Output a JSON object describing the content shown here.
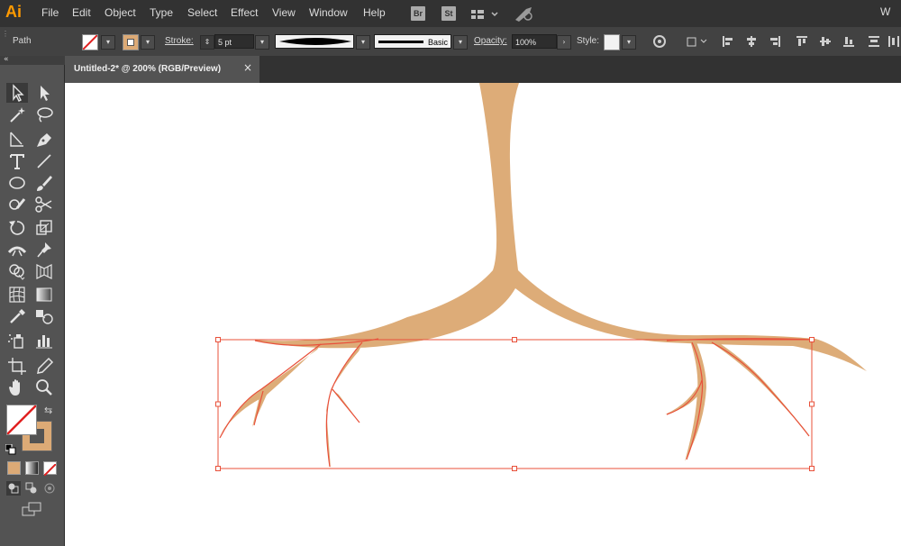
{
  "app": {
    "logo": "Ai"
  },
  "menu": [
    "File",
    "Edit",
    "Object",
    "Type",
    "Select",
    "Effect",
    "View",
    "Window",
    "Help"
  ],
  "menu_badges": {
    "bridge": "Br",
    "stock": "St"
  },
  "menubar_right_text": "W",
  "control_bar": {
    "selection_type": "Path",
    "stroke_label": "Stroke:",
    "stroke_weight": "5 pt",
    "brush_label": "Basic",
    "opacity_label": "Opacity:",
    "opacity_value": "100%",
    "style_label": "Style:"
  },
  "document": {
    "tab_title": "Untitled-2* @ 200% (RGB/Preview)",
    "close_glyph": "×"
  },
  "colors": {
    "fill": "#dcaa76",
    "artwork": "#ddac78",
    "selection": "#e8503a",
    "canvas": "#ffffff",
    "panel": "#535353",
    "menubar": "#323232",
    "logo": "#ff9a00"
  },
  "tools": [
    "selection-tool",
    "direct-selection-tool",
    "magic-wand-tool",
    "lasso-tool",
    "line-segment-tool",
    "pen-tool",
    "type-tool",
    "line-tool",
    "ellipse-tool",
    "paintbrush-tool",
    "shaper-tool",
    "scissors-tool",
    "rotate-tool",
    "scale-tool",
    "width-tool",
    "puppet-warp-tool",
    "shape-builder-tool",
    "perspective-grid-tool",
    "mesh-tool",
    "gradient-tool",
    "eyedropper-tool",
    "blend-tool",
    "symbol-sprayer-tool",
    "column-graph-tool",
    "artboard-tool",
    "slice-tool",
    "hand-tool",
    "zoom-tool"
  ]
}
